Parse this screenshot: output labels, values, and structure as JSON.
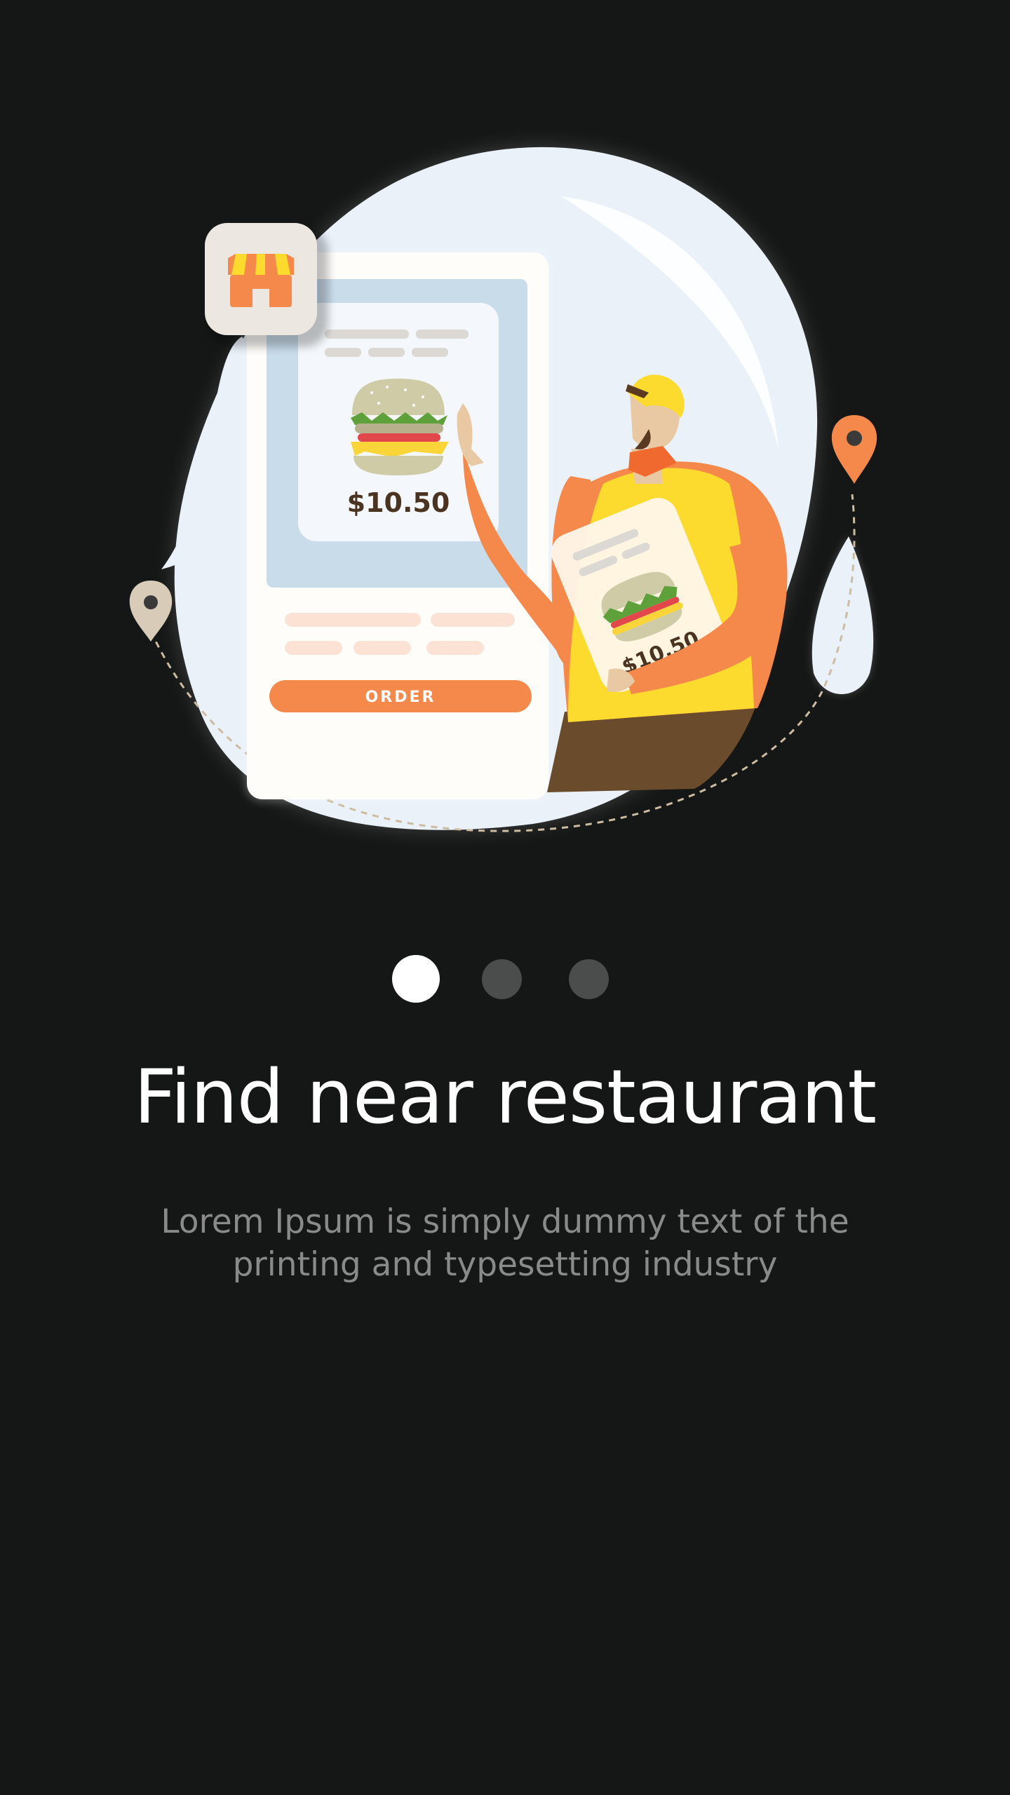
{
  "onboarding": {
    "illustration": {
      "price_label": "$10.50",
      "order_button_label": "ORDER",
      "store_icon": "store-icon",
      "location_icon": "location-pin-icon"
    },
    "pagination": {
      "total": 3,
      "active_index": 0
    },
    "title": "Find near restaurant",
    "subtitle": "Lorem Ipsum is simply dummy text of the printing and typesetting industry"
  },
  "colors": {
    "background": "#151616",
    "accent_orange": "#F4894B",
    "accent_yellow": "#FCDB2E",
    "dot_active": "#FFFFFF",
    "dot_inactive": "#4B4C4C",
    "subtitle_text": "#8A8A8A"
  }
}
